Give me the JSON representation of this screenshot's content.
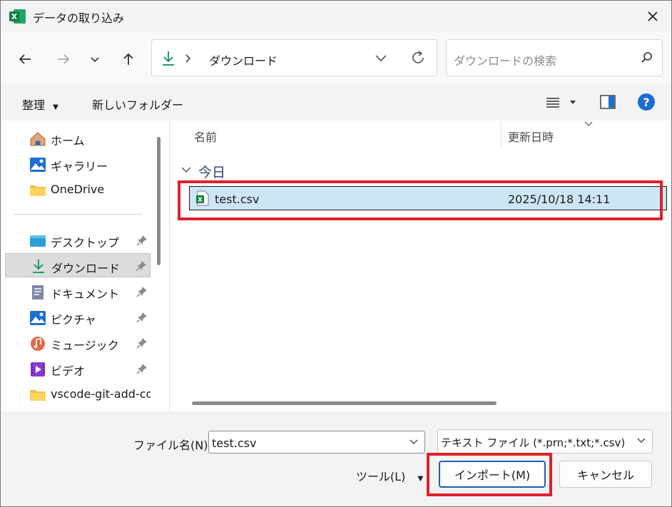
{
  "window": {
    "title": "データの取り込み"
  },
  "address": {
    "path": "ダウンロード"
  },
  "search": {
    "placeholder": "ダウンロードの検索"
  },
  "toolbar": {
    "organize": "整理",
    "new_folder": "新しいフォルダー"
  },
  "sidebar": {
    "items": [
      {
        "label": "ホーム",
        "icon": "home-icon",
        "pinned": false
      },
      {
        "label": "ギャラリー",
        "icon": "gallery-icon",
        "pinned": false
      },
      {
        "label": "OneDrive",
        "icon": "folder-icon",
        "pinned": false
      },
      {
        "label": "デスクトップ",
        "icon": "desktop-icon",
        "pinned": true
      },
      {
        "label": "ダウンロード",
        "icon": "download-icon",
        "pinned": true,
        "selected": true
      },
      {
        "label": "ドキュメント",
        "icon": "document-icon",
        "pinned": true
      },
      {
        "label": "ピクチャ",
        "icon": "picture-icon",
        "pinned": true
      },
      {
        "label": "ミュージック",
        "icon": "music-icon",
        "pinned": true
      },
      {
        "label": "ビデオ",
        "icon": "video-icon",
        "pinned": true
      },
      {
        "label": "vscode-git-add-co",
        "icon": "folder-icon",
        "pinned": false
      }
    ]
  },
  "file_list": {
    "columns": {
      "name": "名前",
      "modified": "更新日時"
    },
    "group": "今日",
    "files": [
      {
        "name": "test.csv",
        "modified": "2025/10/18 14:11"
      }
    ]
  },
  "footer": {
    "filename_label": "ファイル名(N):",
    "filename_value": "test.csv",
    "filetype_value": "テキスト ファイル (*.prn;*.txt;*.csv)",
    "tools_label": "ツール(L)",
    "import_label": "インポート(M)",
    "cancel_label": "キャンセル"
  },
  "colors": {
    "highlight": "#e0202a",
    "selection": "#cde6f7",
    "help_blue": "#1a6fd0",
    "excel_green": "#107c41"
  }
}
